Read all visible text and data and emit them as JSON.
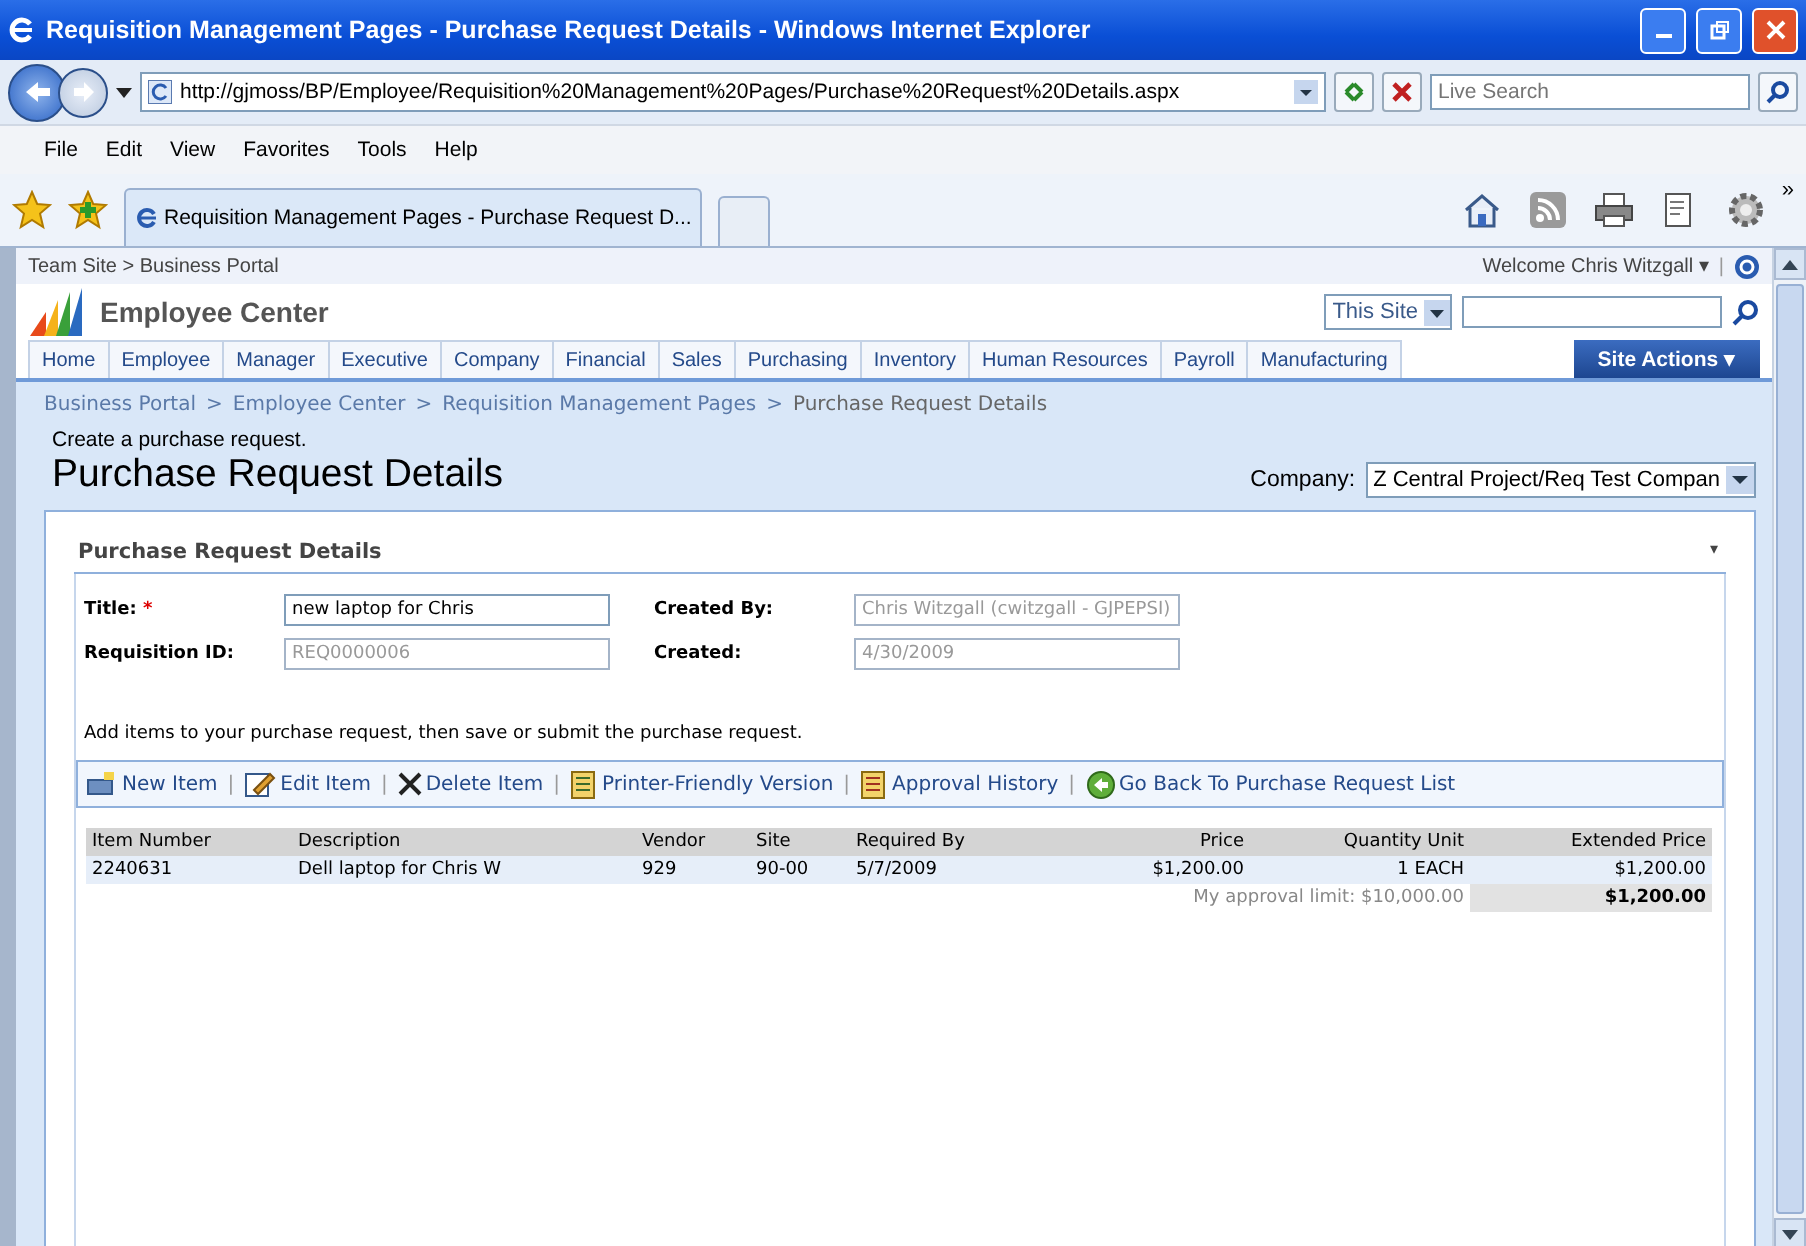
{
  "window": {
    "title": "Requisition Management Pages - Purchase Request Details - Windows Internet Explorer"
  },
  "browser": {
    "address": "http://gjmoss/BP/Employee/Requisition%20Management%20Pages/Purchase%20Request%20Details.aspx",
    "search_placeholder": "Live Search",
    "menu": [
      "File",
      "Edit",
      "View",
      "Favorites",
      "Tools",
      "Help"
    ],
    "tab_title": "Requisition Management Pages - Purchase Request D...",
    "chevron": "»"
  },
  "page": {
    "top_breadcrumb": "Team Site > Business Portal",
    "welcome": "Welcome Chris Witzgall ▾",
    "site_name": "Employee Center",
    "search_scope": "This Site",
    "nav": [
      {
        "label": "Home",
        "selected": false
      },
      {
        "label": "Employee",
        "selected": false
      },
      {
        "label": "Manager",
        "selected": false
      },
      {
        "label": "Executive",
        "selected": false
      },
      {
        "label": "Company",
        "selected": false
      },
      {
        "label": "Financial",
        "selected": false
      },
      {
        "label": "Sales",
        "selected": false
      },
      {
        "label": "Purchasing",
        "selected": false
      },
      {
        "label": "Inventory",
        "selected": false
      },
      {
        "label": "Human Resources",
        "selected": false
      },
      {
        "label": "Payroll",
        "selected": false
      },
      {
        "label": "Manufacturing",
        "selected": false
      }
    ],
    "site_actions": "Site Actions ▾",
    "top_separator": "|",
    "crumb_separator": ">",
    "breadcrumb": [
      "Business Portal",
      "Employee Center",
      "Requisition Management Pages",
      "Purchase Request Details"
    ],
    "description": "Create a purchase request.",
    "heading": "Purchase Request Details",
    "company_label": "Company:",
    "company_value": "Z Central Project/Req Test Compan",
    "panel": {
      "title": "Purchase Request Details",
      "menu_mark": "▾",
      "fields": [
        {
          "label": "Title:",
          "required": true,
          "value": "new laptop for Chris",
          "disabled": false
        },
        {
          "label": "Created By:",
          "required": false,
          "value": "Chris Witzgall (cwitzgall - GJPEPSI)",
          "disabled": true
        },
        {
          "label": "Requisition ID:",
          "required": false,
          "value": "REQ0000006",
          "disabled": true
        },
        {
          "label": "Created:",
          "required": false,
          "value": "4/30/2009",
          "disabled": true
        }
      ],
      "instructions": "Add items to your purchase request, then save or submit the purchase request.",
      "required_mark": "*",
      "toolbar_separator": "|",
      "toolbar": [
        {
          "label": "New Item",
          "kind": "new"
        },
        {
          "label": "Edit Item",
          "kind": "edit"
        },
        {
          "label": "Delete Item",
          "kind": "delete"
        },
        {
          "label": "Printer-Friendly Version",
          "kind": "print"
        },
        {
          "label": "Approval History",
          "kind": "history"
        },
        {
          "label": "Go Back To Purchase Request List",
          "kind": "back"
        }
      ],
      "table": {
        "columns": [
          "Item Number",
          "Description",
          "Vendor",
          "Site",
          "Required By",
          "Price",
          "Quantity Unit",
          "Extended Price"
        ],
        "rows": [
          [
            "2240631",
            "Dell laptop for Chris W",
            "929",
            "90-00",
            "5/7/2009",
            "$1,200.00",
            "1 EACH",
            "$1,200.00"
          ]
        ],
        "approval_limit": "My approval limit: $10,000.00",
        "total": "$1,200.00"
      }
    }
  }
}
